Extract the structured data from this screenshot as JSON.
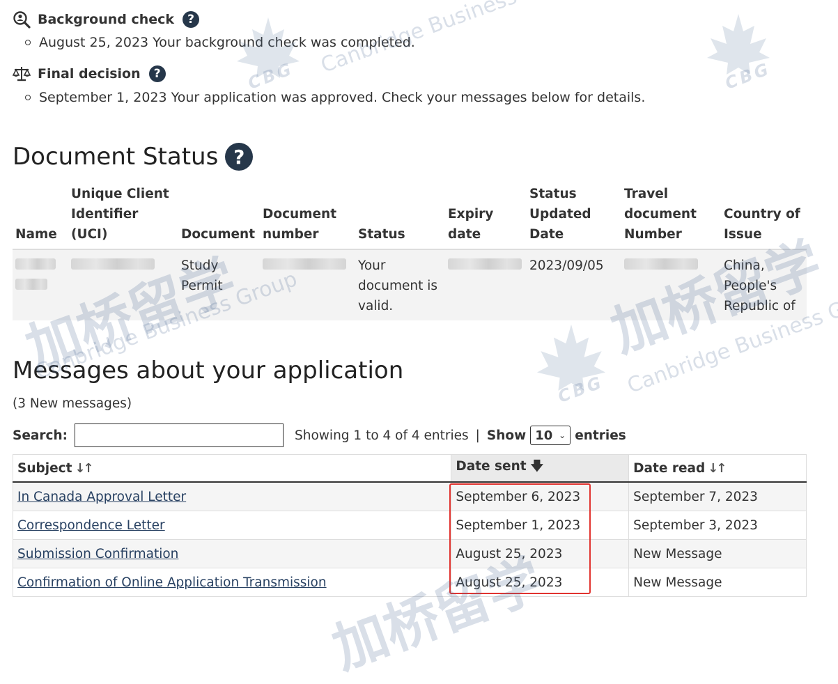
{
  "history": {
    "background_check": {
      "title": "Background check",
      "help": "?",
      "item": "August 25, 2023 Your background check was completed."
    },
    "final_decision": {
      "title": "Final decision",
      "help": "?",
      "item": "September 1, 2023 Your application was approved. Check your messages below for details."
    }
  },
  "document_status": {
    "heading": "Document Status",
    "help": "?",
    "columns": [
      "Name",
      "Unique Client Identifier (UCI)",
      "Document",
      "Document number",
      "Status",
      "Expiry date",
      "Status Updated Date",
      "Travel document Number",
      "Country of Issue"
    ],
    "row": {
      "document": "Study Permit",
      "status": "Your document is valid.",
      "status_updated": "2023/09/05",
      "country": "China, People's Republic of"
    }
  },
  "messages": {
    "heading": "Messages about your application",
    "count": "(3 New messages)",
    "search_label": "Search:",
    "search_value": "",
    "showing": "Showing 1 to 4 of 4 entries",
    "separator": "|",
    "show_label": "Show",
    "entries_value": "10",
    "entries_label": "entries",
    "columns": {
      "subject": "Subject",
      "date_sent": "Date sent",
      "date_read": "Date read"
    },
    "rows": [
      {
        "subject": "In Canada Approval Letter",
        "sent": "September 6, 2023",
        "read": "September 7, 2023"
      },
      {
        "subject": "Correspondence Letter",
        "sent": "September 1, 2023",
        "read": "September 3, 2023"
      },
      {
        "subject": "Submission Confirmation",
        "sent": "August 25, 2023",
        "read": "New Message"
      },
      {
        "subject": "Confirmation of Online Application Transmission",
        "sent": "August 25, 2023",
        "read": "New Message"
      }
    ]
  },
  "watermark": {
    "cn": "加桥留学",
    "en": "Canbridge Business Group",
    "abbr": "CBG"
  },
  "colors": {
    "badge": "#26374a",
    "link": "#284162",
    "highlight": "#e1332f"
  }
}
